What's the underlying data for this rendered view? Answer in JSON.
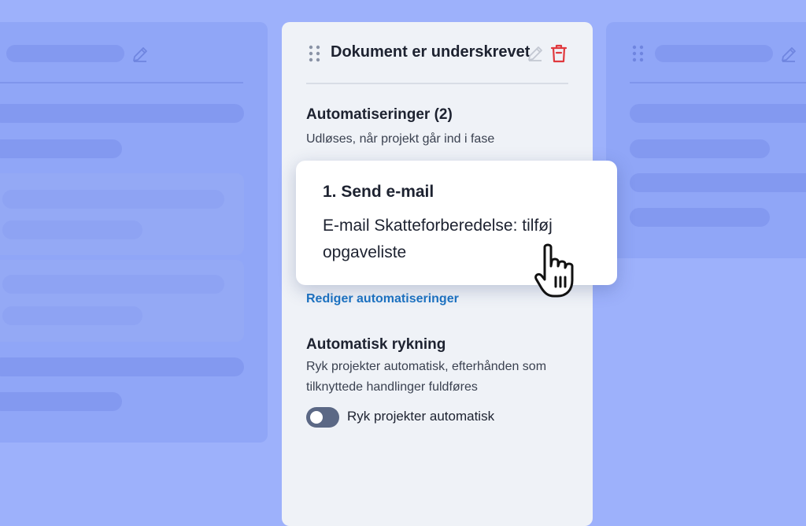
{
  "panel": {
    "title": "Dokument er underskrevet",
    "automations_heading": "Automatiseringer (2)",
    "automations_desc": "Udløses, når projekt går ind i fase",
    "edit_automations_link": "Rediger automatiseringer",
    "auto_advance_heading": "Automatisk rykning",
    "auto_advance_desc": "Ryk projekter automatisk, efterhånden som tilknyttede handlinger fuldføres",
    "toggle_label": "Ryk projekter automatisk",
    "toggle_on": false
  },
  "popup": {
    "title": "1. Send e-mail",
    "body": "E-mail Skatteforberedelse: tilføj opgaveliste"
  },
  "colors": {
    "background": "#9db1fb",
    "panel": "#eff2f7",
    "link": "#1d73c2",
    "delete": "#e0393e",
    "toggle": "#5b6885"
  },
  "icons": [
    "drag-handle-icon",
    "pencil-icon",
    "trash-icon",
    "hand-cursor-icon"
  ]
}
